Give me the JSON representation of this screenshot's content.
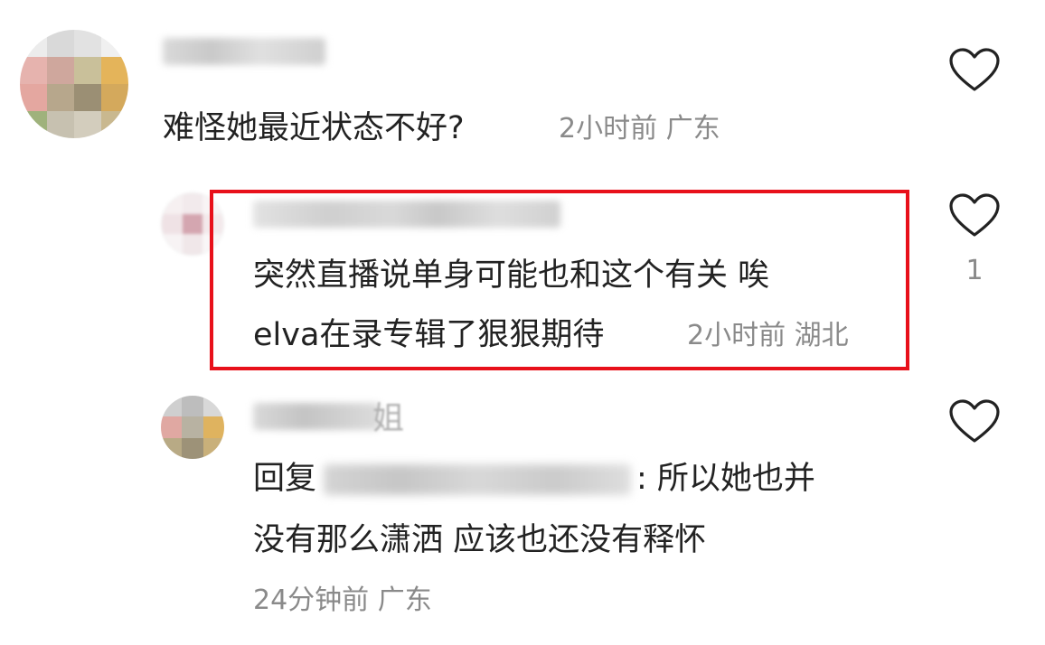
{
  "comments": [
    {
      "text": "难怪她最近状态不好?",
      "meta": "2小时前 广东",
      "like_count": ""
    },
    {
      "text_line1": "突然直播说单身可能也和这个有关 唉",
      "text_line2": "elva在录专辑了狠狠期待",
      "meta": "2小时前 湖北",
      "like_count": "1"
    },
    {
      "username_visible": "姐",
      "reply_prefix": "回复",
      "text_line1_suffix": ": 所以她也并",
      "text_line2": "没有那么潇洒 应该也还没有释怀",
      "meta": "24分钟前 广东",
      "like_count": ""
    }
  ],
  "colors": {
    "highlight": "#e8101a",
    "meta_text": "#8a8a8a",
    "body_text": "#222222"
  },
  "icons": [
    "heart-icon"
  ]
}
